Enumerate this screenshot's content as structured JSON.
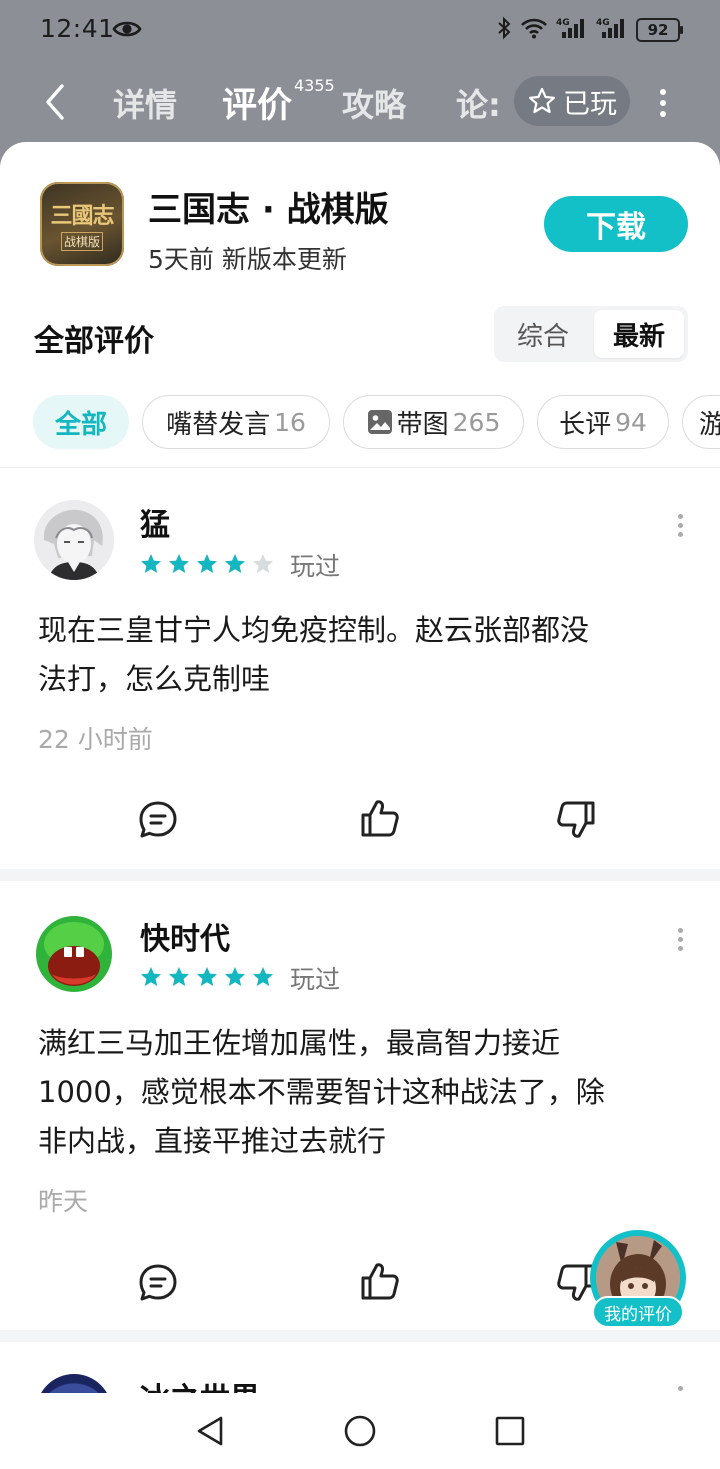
{
  "status_bar": {
    "time": "12:41",
    "network_1": "4G",
    "network_2": "4G",
    "battery": "92"
  },
  "top_nav": {
    "tabs": [
      {
        "label": "详情"
      },
      {
        "label": "评价",
        "count": "4355",
        "active": true
      },
      {
        "label": "攻略"
      },
      {
        "label": "论:"
      }
    ],
    "played_label": "已玩"
  },
  "game": {
    "name": "三国志 · 战棋版",
    "update_text": "5天前 新版本更新",
    "icon_text_top": "三國志",
    "icon_text_bottom": "战棋版",
    "download_label": "下载"
  },
  "reviews_header": {
    "title": "全部评价",
    "sort_options": [
      "综合",
      "最新"
    ],
    "selected_sort": "最新"
  },
  "filter_chips": [
    {
      "label": "全部",
      "count": "",
      "active": true
    },
    {
      "label": "嘴替发言",
      "count": "16"
    },
    {
      "label": "带图",
      "count": "265"
    },
    {
      "label": "长评",
      "count": "94"
    },
    {
      "label": "游",
      "count": ""
    }
  ],
  "reviews": [
    {
      "username": "猛",
      "rating": 4,
      "max_rating": 5,
      "played_tag": "玩过",
      "text_lines": [
        "现在三皇甘宁人均免疫控制。赵云张部都没",
        "法打，怎么克制哇"
      ],
      "time": "22 小时前"
    },
    {
      "username": "快时代",
      "rating": 5,
      "max_rating": 5,
      "played_tag": "玩过",
      "text_lines": [
        "满红三马加王佐增加属性，最高智力接近",
        "1000，感觉根本不需要智计这种战法了，除",
        "非内战，直接平推过去就行"
      ],
      "time": "昨天"
    },
    {
      "username": "冰之世界"
    }
  ],
  "my_review_label": "我的评价",
  "colors": {
    "accent": "#14c0c8",
    "star": "#14b7c0",
    "header_bg": "#8c8f95"
  }
}
